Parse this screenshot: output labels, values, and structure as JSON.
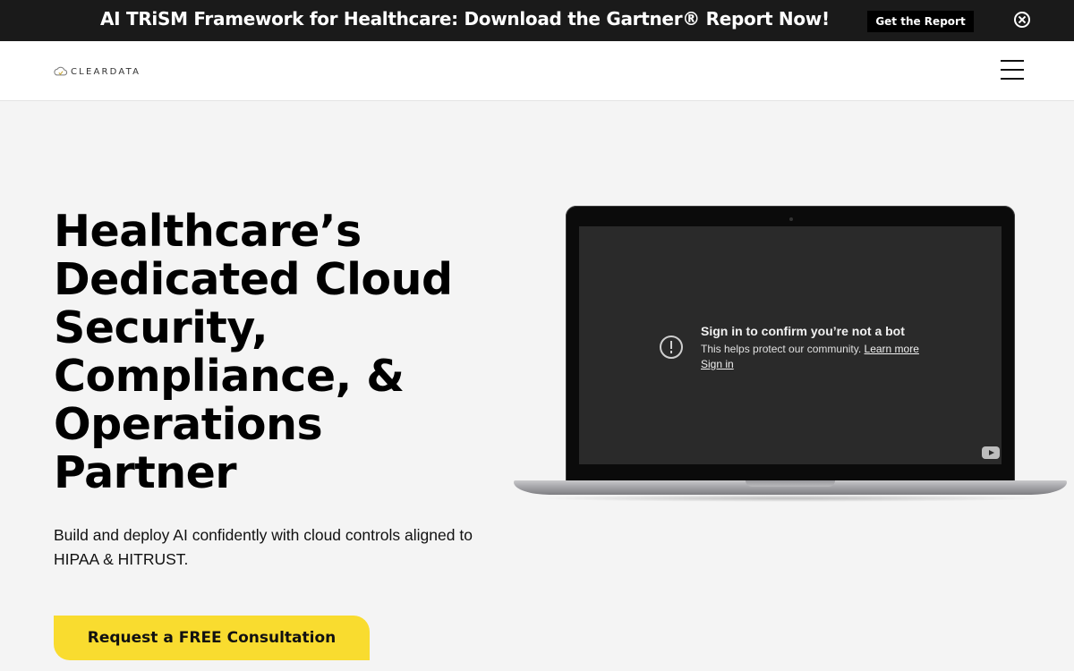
{
  "announcement": {
    "text": "AI TRiSM Framework for Healthcare: Download the Gartner® Report Now!",
    "button_label": "Get the Report",
    "close_icon": "close-circle-icon"
  },
  "header": {
    "logo_text": "CLEARDATA",
    "logo_icon": "cloud-shield-logo",
    "menu_icon": "hamburger-menu-icon"
  },
  "hero": {
    "title": "Healthcare’s Dedicated Cloud Security, Compliance, & Operations Partner",
    "subtitle": "Build and deploy AI confidently with cloud controls aligned to HIPAA & HITRUST.",
    "cta_label": "Request a FREE Consultation"
  },
  "video": {
    "heading": "Sign in to confirm you’re not a bot",
    "message": "This helps protect our community.",
    "learn_more": "Learn more",
    "sign_in": "Sign in",
    "alert_icon": "exclamation-circle-icon",
    "youtube_icon": "youtube-logo-icon"
  },
  "colors": {
    "announcement_bg": "#1a1a1a",
    "cta_bg": "#f9dc2f",
    "page_bg": "#f4f4f4"
  }
}
